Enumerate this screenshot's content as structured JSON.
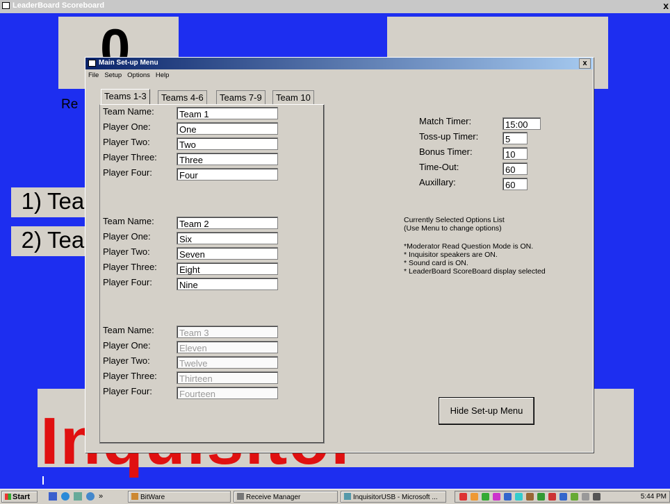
{
  "outer": {
    "title": "LeaderBoard Scoreboard",
    "close": "x"
  },
  "scoreboard": {
    "score_left": "0",
    "re_label": "Re",
    "ranks": [
      {
        "num": "1)",
        "name": "Tea"
      },
      {
        "num": "2)",
        "name": "Tea"
      }
    ],
    "brand": "Inquisitor",
    "brand_color": "#e01010"
  },
  "dialog": {
    "title": "Main Set-up Menu",
    "close": "x",
    "menu": [
      "File",
      "Setup",
      "Options",
      "Help"
    ],
    "tabs": [
      "Teams 1-3",
      "Teams 4-6",
      "Teams 7-9",
      "Team 10"
    ],
    "field_labels": [
      "Team Name:",
      "Player One:",
      "Player Two:",
      "Player Three:",
      "Player Four:"
    ],
    "teams": [
      {
        "values": [
          "Team 1",
          "One",
          "Two",
          "Three",
          "Four"
        ]
      },
      {
        "values": [
          "Team 2",
          "Six",
          "Seven",
          "Eight",
          "Nine"
        ]
      },
      {
        "values": [
          "Team 3",
          "Eleven",
          "Twelve",
          "Thirteen",
          "Fourteen"
        ]
      }
    ],
    "timers": [
      {
        "label": "Match Timer:",
        "value": "15:00"
      },
      {
        "label": "Toss-up Timer:",
        "value": "5"
      },
      {
        "label": "Bonus Timer:",
        "value": "10"
      },
      {
        "label": "Time-Out:",
        "value": "60"
      },
      {
        "label": "Auxillary:",
        "value": "60"
      }
    ],
    "options_heading1": "Currently Selected Options List",
    "options_heading2": "(Use Menu to change options)",
    "options": [
      "*Moderator Read Question Mode is ON.",
      "* Inquisitor speakers are ON.",
      "* Sound card is ON.",
      "* LeaderBoard ScoreBoard display selected"
    ],
    "hide_button": "Hide Set-up Menu"
  },
  "taskbar": {
    "start": "Start",
    "chevron": "»",
    "tasks": [
      "BitWare",
      "Receive Manager",
      "InquisitorUSB - Microsoft ..."
    ],
    "clock": "5:44 PM"
  }
}
